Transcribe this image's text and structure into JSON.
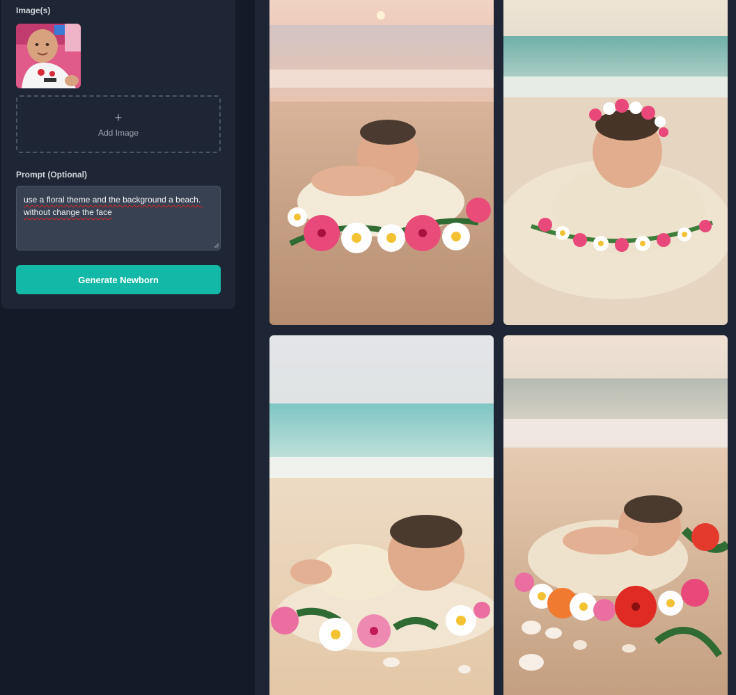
{
  "form": {
    "images_label": "Image(s)",
    "add_image_label": "Add Image",
    "add_image_icon": "plus-icon",
    "prompt_label": "Prompt (Optional)",
    "prompt_value": "use a floral theme and the background a beach. without change the face",
    "generate_label": "Generate Newborn"
  },
  "colors": {
    "accent": "#14b8a6",
    "panel": "#1e2635",
    "background": "#141b28"
  }
}
